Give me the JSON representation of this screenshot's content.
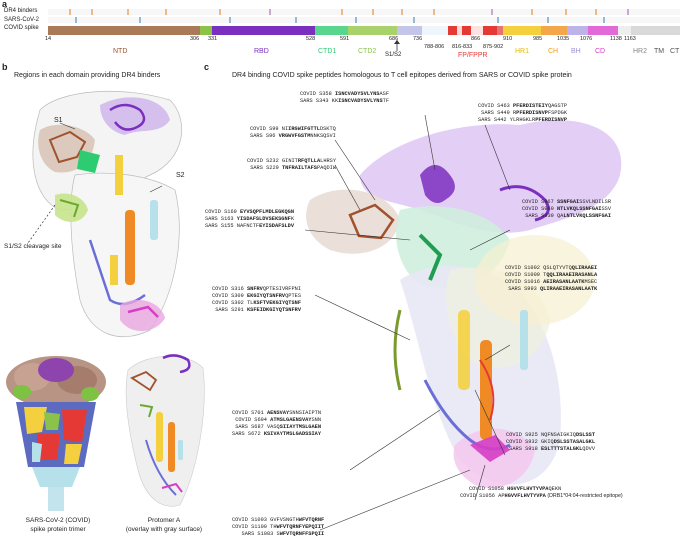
{
  "panels": {
    "a": "a",
    "b": "b",
    "c": "c"
  },
  "panel_a": {
    "row_labels": [
      "DR4 binders",
      "SARS-CoV-2",
      "COVID spike"
    ],
    "positions": [
      "14",
      "306",
      "331",
      "528",
      "591",
      "686",
      "736",
      "788-806",
      "816-833",
      "866",
      "875-902",
      "910",
      "985",
      "1035",
      "1076",
      "1138",
      "1163"
    ],
    "s1s2": "S1/S2",
    "domains": [
      {
        "name": "NTD",
        "color": "#a0522d"
      },
      {
        "name": "RBD",
        "color": "#7b2fbe"
      },
      {
        "name": "CTD1",
        "color": "#2ecc71"
      },
      {
        "name": "CTD2",
        "color": "#8bc34a"
      },
      {
        "name": "FP/FPPR",
        "color": "#e53935"
      },
      {
        "name": "HR1",
        "color": "#f4d03f"
      },
      {
        "name": "CH",
        "color": "#f39c12"
      },
      {
        "name": "BH",
        "color": "#9b8fd6"
      },
      {
        "name": "CD",
        "color": "#d63ec4"
      },
      {
        "name": "HR2",
        "color": "#999999"
      },
      {
        "name": "TM",
        "color": "#666666"
      },
      {
        "name": "CT",
        "color": "#666666"
      }
    ]
  },
  "panel_b": {
    "title": "Regions in each domain providing DR4 binders",
    "labels": {
      "s1": "S1",
      "s2": "S2",
      "cleavage": "S1/S2 cleavage site"
    },
    "captions": {
      "trimer_1": "SARS-CoV-2 (COVID)",
      "trimer_2": "spike protein trimer",
      "protomer_1": "Protomer A",
      "protomer_2": "(overlay with gray surface)"
    }
  },
  "panel_c": {
    "title": "DR4 binding COVID spike peptides homologous to T cell epitopes derived from SARS or COVID spike protein",
    "groups": [
      {
        "lines": [
          {
            "id": "COVID S358 ",
            "pre": "",
            "core": "ISNCVADYSVLYNS",
            "post": "ASF"
          },
          {
            "id": "SARS S343 ",
            "pre": "KK",
            "core": "ISNCVADYSVLYNS",
            "post": "TF"
          }
        ]
      },
      {
        "lines": [
          {
            "id": "COVID S463 ",
            "pre": "",
            "core": "PFERDISTEIY",
            "post": "QAGSTP"
          },
          {
            "id": "SARS S449 ",
            "pre": "R",
            "core": "PFERDISNVP",
            "post": "FSPDGK"
          },
          {
            "id": "SARS S442 ",
            "pre": "YLRHGKLR",
            "core": "PFERDISNVP",
            "post": ""
          }
        ]
      },
      {
        "lines": [
          {
            "id": "COVID S99 ",
            "pre": "NI",
            "core": "IRGWIFGTTL",
            "post": "DSKTQ"
          },
          {
            "id": "SARS S96 ",
            "pre": "",
            "core": "VRGWVFGSTM",
            "post": "NNKSQSVI"
          }
        ]
      },
      {
        "lines": [
          {
            "id": "COVID S232 ",
            "pre": "GINIT",
            "core": "RFQTLLA",
            "post": "LHRSY"
          },
          {
            "id": "SARS S229 ",
            "pre": "",
            "core": "TNFRAILTAFS",
            "post": "PAQDIW"
          }
        ]
      },
      {
        "lines": [
          {
            "id": "COVID S967 ",
            "pre": "",
            "core": "SSNFGAI",
            "post": "SSVLNDILSR"
          },
          {
            "id": "COVID S960 ",
            "pre": "",
            "core": "NTLVKQLSSNFGAI",
            "post": "SSV"
          },
          {
            "id": "SARS S939 ",
            "pre": "QA",
            "core": "LNTLVKQLSSNFGAI",
            "post": ""
          }
        ]
      },
      {
        "lines": [
          {
            "id": "COVID S169 ",
            "pre": "",
            "core": "EYVSQPFLMDLEGKQGN",
            "post": ""
          },
          {
            "id": "SARS S163 ",
            "pre": "",
            "core": "YISDAFSLDVSEKSGNF",
            "post": "K"
          },
          {
            "id": "SARS S155 ",
            "pre": "NAFNCTF",
            "core": "EYISDAFSLDV",
            "post": ""
          }
        ]
      },
      {
        "lines": [
          {
            "id": "COVID S1002 ",
            "pre": "QSLQTYVTQ",
            "core": "QLIRAAEI",
            "post": ""
          },
          {
            "id": "COVID S1009 ",
            "pre": "T",
            "core": "QQLIRAAEIRASANLA",
            "post": ""
          },
          {
            "id": "COVID S1016 ",
            "pre": "",
            "core": "AEIRASANLAATK",
            "post": "MSEC"
          },
          {
            "id": "SARS S993 ",
            "pre": "",
            "core": "QLIRAAEIRASANLAATK",
            "post": ""
          }
        ]
      },
      {
        "lines": [
          {
            "id": "COVID S316 ",
            "pre": "",
            "core": "SNFRV",
            "post": "QPTESIVRFPNI"
          },
          {
            "id": "COVID S309 ",
            "pre": "",
            "core": "EKGIYQTSNFRV",
            "post": "QPTES"
          },
          {
            "id": "COVID S302 ",
            "pre": "TL",
            "core": "KSFTVEKGIYQTSNF",
            "post": ""
          },
          {
            "id": "SARS S291 ",
            "pre": "",
            "core": "KSFEIDKGIYQTSNFRV",
            "post": ""
          }
        ]
      },
      {
        "lines": [
          {
            "id": "COVID S701 ",
            "pre": "",
            "core": "AENSVAY",
            "post": "SNNSIAIPTN"
          },
          {
            "id": "COVID S694 ",
            "pre": "",
            "core": "ATMSLGAENSVAY",
            "post": "SNN"
          },
          {
            "id": "SARS S687 ",
            "pre": "VASQ",
            "core": "SIIAYTMSLGAEN",
            "post": ""
          },
          {
            "id": "SARS S672 ",
            "pre": "",
            "core": "KSIVAYTMSLGADSSIAY",
            "post": ""
          }
        ]
      },
      {
        "lines": [
          {
            "id": "COVID S925 ",
            "pre": "NQFNSAIGKIQ",
            "core": "DSLSST",
            "post": ""
          },
          {
            "id": "COVID S932 ",
            "pre": "GKIQ",
            "core": "DSLSSTASALGKL",
            "post": ""
          },
          {
            "id": "SARS S918 ",
            "pre": "",
            "core": "ESLTTTSTALGKL",
            "post": "QDVV"
          }
        ]
      },
      {
        "lines": [
          {
            "id": "COVID S1058 ",
            "pre": "",
            "core": "HGVVFLHVTYVPA",
            "post": "QEKN"
          },
          {
            "id": "COVID S1056 ",
            "pre": "AP",
            "core": "HGVVFLHVTYVPA",
            "post": " (DRB1*04:04-restricted epitope)"
          }
        ]
      },
      {
        "lines": [
          {
            "id": "COVID S1093 ",
            "pre": "GVFVSNGTH",
            "core": "WFVTQRNF",
            "post": ""
          },
          {
            "id": "COVID S1100 ",
            "pre": "TH",
            "core": "WFVTQRNFYEPQIIT",
            "post": ""
          },
          {
            "id": "SARS S1083 ",
            "pre": "S",
            "core": "WFVTQRNFFSPQII",
            "post": ""
          }
        ]
      }
    ]
  }
}
